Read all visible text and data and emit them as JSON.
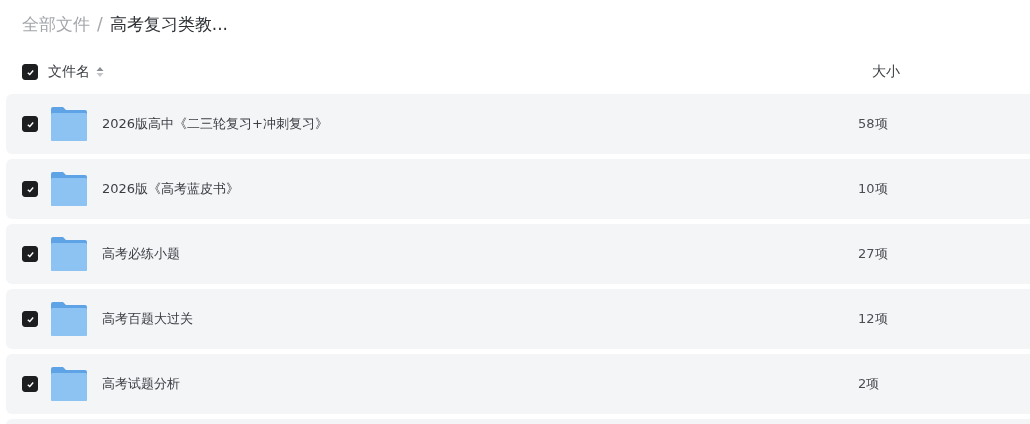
{
  "breadcrumb": [
    {
      "label": "全部文件",
      "current": false
    },
    {
      "label": "高考复习类教...",
      "current": true
    }
  ],
  "breadcrumb_separator": "/",
  "table": {
    "select_all": {
      "checked": true
    },
    "columns": [
      {
        "label": "文件名",
        "sortable": true
      },
      {
        "label": "大小"
      }
    ],
    "rows": [
      {
        "name": "2026版高中《二三轮复习+冲刺复习》",
        "size": "58项",
        "checked": true
      },
      {
        "name": "2026版《高考蓝皮书》",
        "size": "10项",
        "checked": true
      },
      {
        "name": "高考必练小题",
        "size": "27项",
        "checked": true
      },
      {
        "name": "高考百题大过关",
        "size": "12项",
        "checked": true
      },
      {
        "name": "高考试题分析",
        "size": "2项",
        "checked": true
      }
    ]
  }
}
